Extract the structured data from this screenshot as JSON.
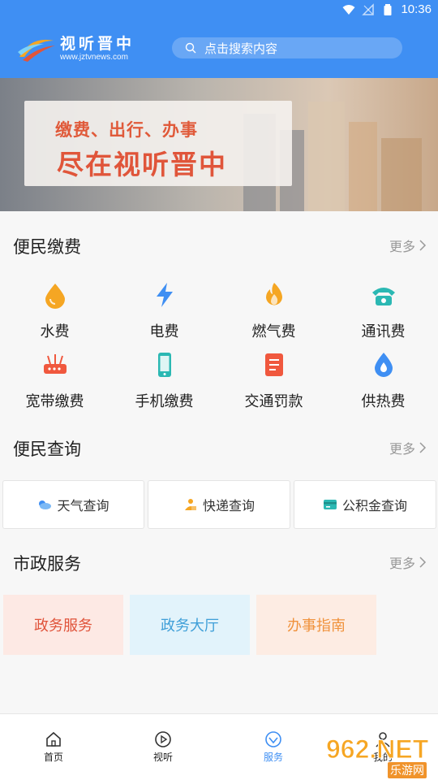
{
  "status": {
    "time": "10:36"
  },
  "header": {
    "brand_name": "视听晋中",
    "brand_url": "www.jztvnews.com",
    "search_placeholder": "点击搜索内容"
  },
  "banner": {
    "line1": "缴费、出行、办事",
    "line2": "尽在视听晋中"
  },
  "payments": {
    "title": "便民缴费",
    "more": "更多",
    "items": [
      {
        "label": "水费",
        "icon": "water-drop-icon",
        "color": "#f5a623"
      },
      {
        "label": "电费",
        "icon": "lightning-icon",
        "color": "#3f8ff3"
      },
      {
        "label": "燃气费",
        "icon": "flame-icon",
        "color": "#f5a623"
      },
      {
        "label": "通讯费",
        "icon": "telephone-icon",
        "color": "#2bb8b3"
      },
      {
        "label": "宽带缴费",
        "icon": "router-icon",
        "color": "#f0583e"
      },
      {
        "label": "手机缴费",
        "icon": "mobile-phone-icon",
        "color": "#2bb8b3"
      },
      {
        "label": "交通罚款",
        "icon": "ticket-icon",
        "color": "#f0583e"
      },
      {
        "label": "供热费",
        "icon": "heat-drop-icon",
        "color": "#3f8ff3"
      }
    ]
  },
  "queries": {
    "title": "便民查询",
    "more": "更多",
    "items": [
      {
        "label": "天气查询",
        "icon": "weather-icon"
      },
      {
        "label": "快递查询",
        "icon": "courier-icon"
      },
      {
        "label": "公积金查询",
        "icon": "card-icon"
      }
    ]
  },
  "municipal": {
    "title": "市政服务",
    "more": "更多",
    "items": [
      {
        "label": "政务服务",
        "bg": "#fde9e4",
        "fg": "#e0533a"
      },
      {
        "label": "政务大厅",
        "bg": "#e2f3fb",
        "fg": "#3f9fd8"
      },
      {
        "label": "办事指南",
        "bg": "#fdece3",
        "fg": "#f0923c"
      }
    ]
  },
  "nav": {
    "items": [
      {
        "label": "首页",
        "icon": "home-icon"
      },
      {
        "label": "视听",
        "icon": "play-icon"
      },
      {
        "label": "服务",
        "icon": "service-icon"
      },
      {
        "label": "我的",
        "icon": "user-icon"
      }
    ]
  },
  "watermark": {
    "big": "962.NET",
    "small": "乐游网"
  }
}
